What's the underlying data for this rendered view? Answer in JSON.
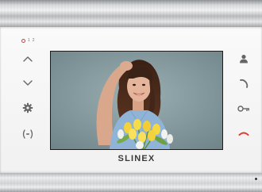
{
  "indicators": {
    "led_color": "#e23b2e",
    "label_1": "1",
    "label_2": "2"
  },
  "left_buttons": [
    {
      "icon": "chevron-up-icon"
    },
    {
      "icon": "chevron-down-icon"
    },
    {
      "icon": "gear-icon"
    },
    {
      "icon": "wireless-signal-icon"
    }
  ],
  "right_buttons": [
    {
      "icon": "person-icon"
    },
    {
      "icon": "phone-answer-icon"
    },
    {
      "icon": "key-icon"
    },
    {
      "icon": "phone-hangup-icon",
      "color": "#e23b2e"
    }
  ],
  "brand": {
    "logo_text": "SLINEX"
  },
  "screen": {
    "content": "video-feed"
  }
}
